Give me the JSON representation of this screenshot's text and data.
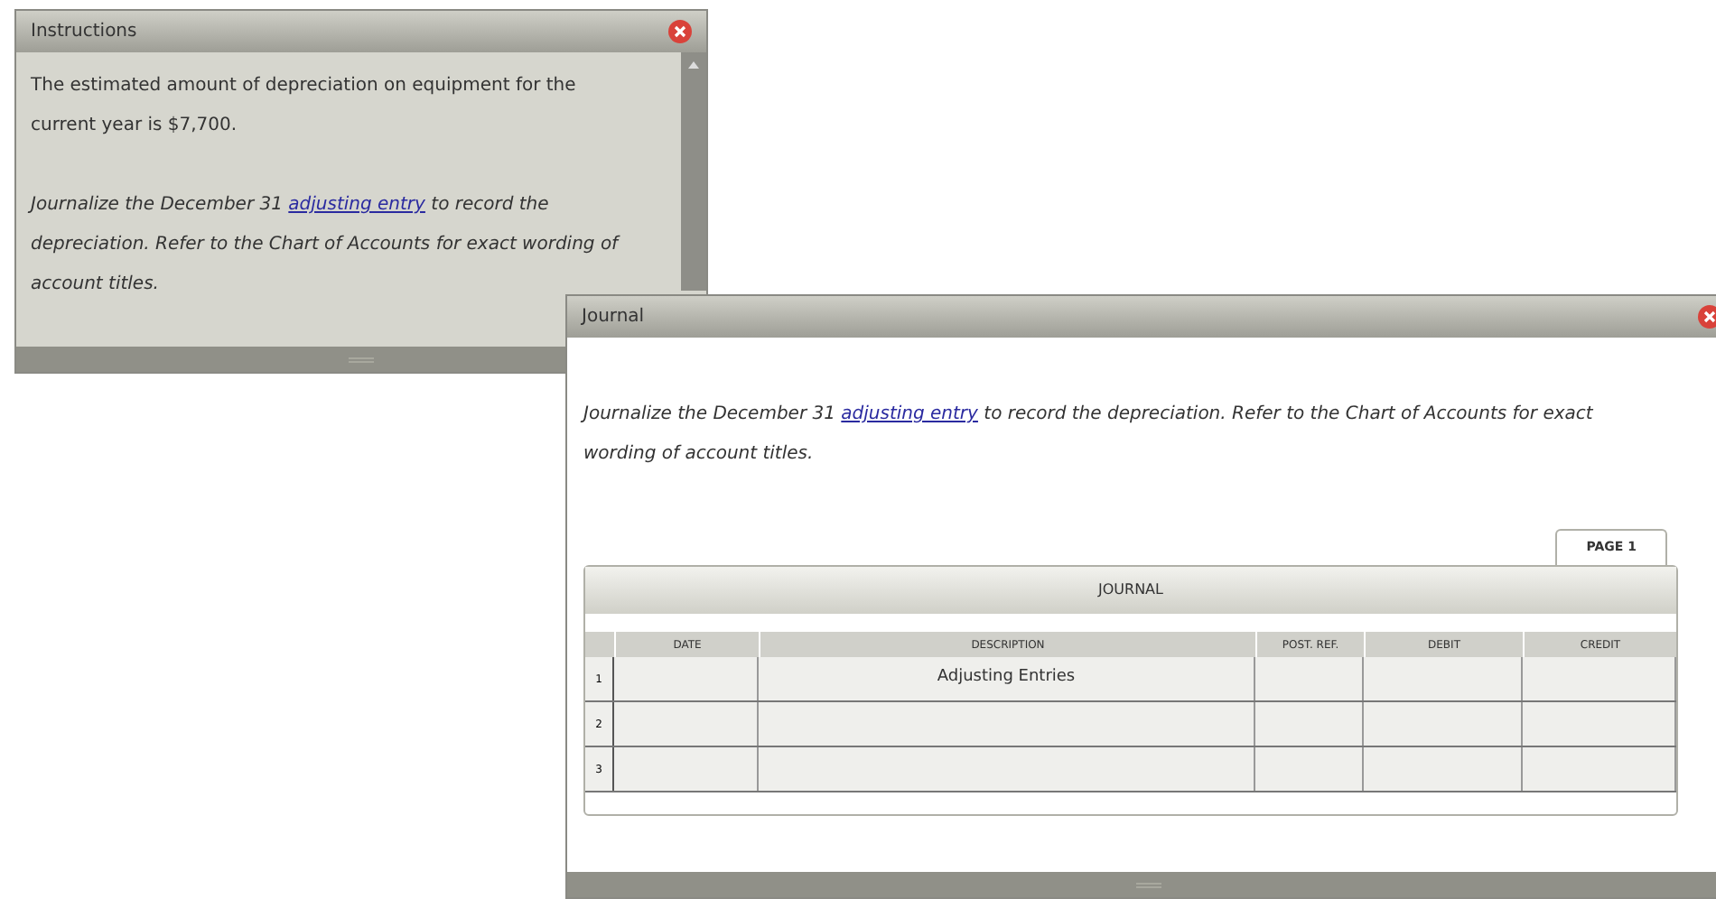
{
  "instructions_window": {
    "title": "Instructions",
    "paragraphs": [
      {
        "before": "The estimated amount of depreciation on equipment for the current year is $7,700.",
        "italic": false
      },
      {
        "before": "Journalize the December 31 ",
        "link": "adjusting entry",
        "after": " to record the depreciation. Refer to the Chart of Accounts for exact wording of account titles.",
        "italic": true
      }
    ]
  },
  "journal_window": {
    "title": "Journal",
    "prompt": {
      "before": "Journalize the December 31 ",
      "link": "adjusting entry",
      "after": " to record the depreciation. Refer to the Chart of Accounts for exact wording of account titles."
    },
    "tabs": [
      {
        "label": "PAGE 1",
        "selected": true
      }
    ],
    "table": {
      "title": "JOURNAL",
      "columns": [
        "DATE",
        "DESCRIPTION",
        "POST. REF.",
        "DEBIT",
        "CREDIT"
      ],
      "rows": [
        {
          "number": "1",
          "cells": [
            "",
            "Adjusting Entries",
            "",
            "",
            ""
          ]
        },
        {
          "number": "2",
          "cells": [
            "",
            "",
            "",
            "",
            ""
          ]
        },
        {
          "number": "3",
          "cells": [
            "",
            "",
            "",
            "",
            ""
          ]
        }
      ]
    }
  }
}
